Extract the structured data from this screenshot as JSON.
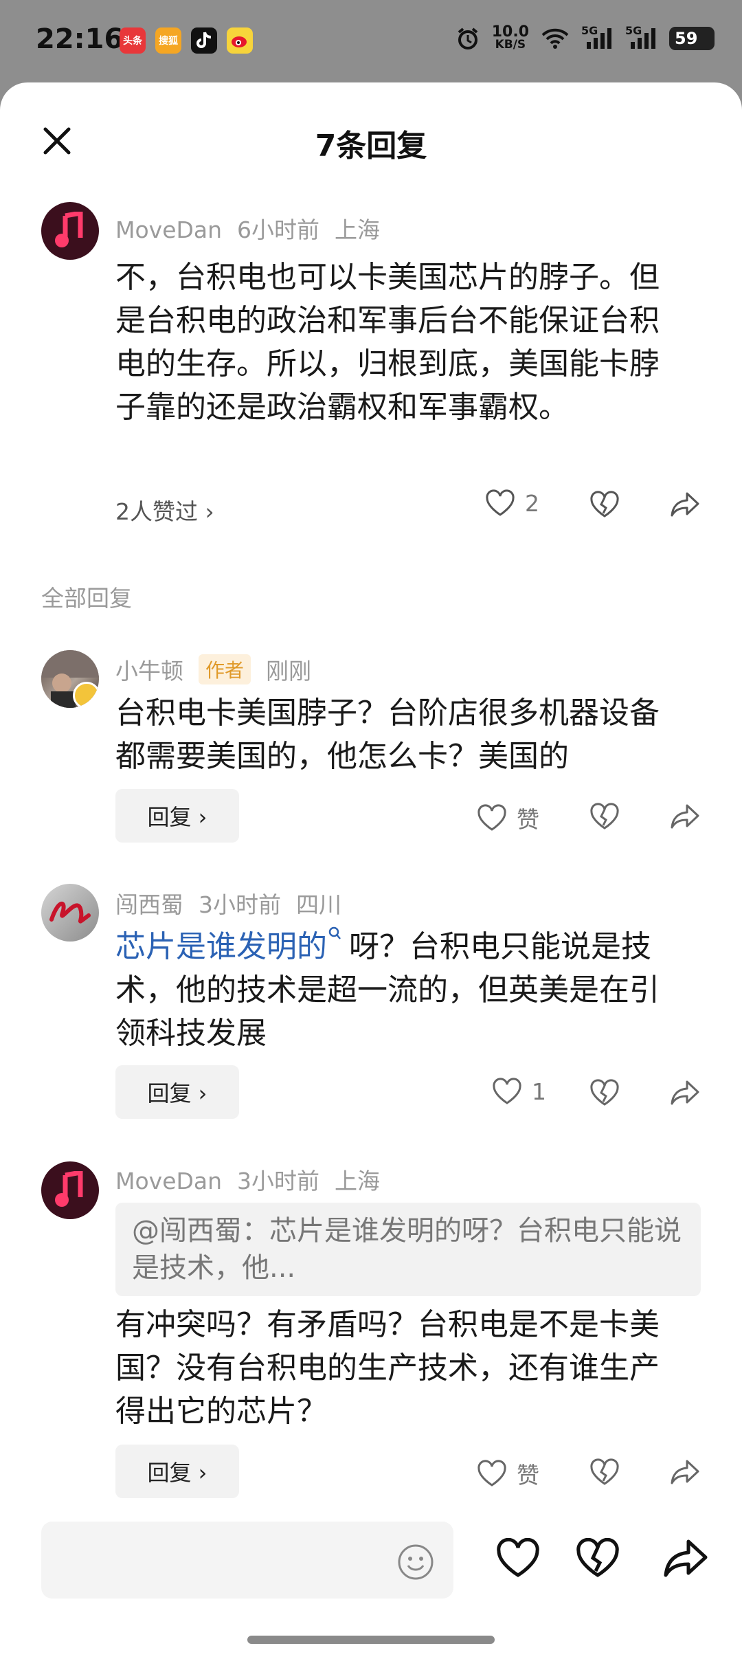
{
  "status_bar": {
    "time": "22:16",
    "apps": [
      "头条",
      "搜狐",
      "抖音",
      "微博"
    ],
    "net_speed_value": "10.0",
    "net_speed_unit": "KB/S",
    "signal_1": "5G",
    "signal_2": "5G",
    "battery": "59"
  },
  "header": {
    "title": "7条回复"
  },
  "main_comment": {
    "user": "MoveDan",
    "time": "6小时前",
    "location": "上海",
    "text": "不，台积电也可以卡美国芯片的脖子。但是台积电的政治和军事后台不能保证台积电的生存。所以，归根到底，美国能卡脖子靠的还是政治霸权和军事霸权。",
    "likes_link": "2人赞过 ›",
    "like_count": "2"
  },
  "section_label": "全部回复",
  "replies": [
    {
      "user": "小牛顿",
      "tag": "作者",
      "time": "刚刚",
      "text": "台积电卡美国脖子？台阶店很多机器设备都需要美国的，他怎么卡？美国的",
      "reply_label": "回复 ›",
      "like_label": "赞"
    },
    {
      "user": "闯西蜀",
      "time": "3小时前",
      "location": "四川",
      "link_text": "芯片是谁发明的",
      "text": "呀？台积电只能说是技术，他的技术是超一流的，但英美是在引领科技发展",
      "reply_label": "回复 ›",
      "like_label": "1"
    },
    {
      "user": "MoveDan",
      "time": "3小时前",
      "location": "上海",
      "quote": "@闯西蜀：芯片是谁发明的呀？台积电只能说是技术，他...",
      "text": "有冲突吗？有矛盾吗？台积电是不是卡美国？没有台积电的生产技术，还有谁生产得出它的芯片？",
      "reply_label": "回复 ›",
      "like_label": "赞"
    }
  ],
  "bottom_bar": {
    "input_placeholder": ""
  },
  "colors": {
    "link": "#2b62b4",
    "author_tag_bg": "#fdf0dc",
    "author_tag_text": "#e09a2a"
  }
}
